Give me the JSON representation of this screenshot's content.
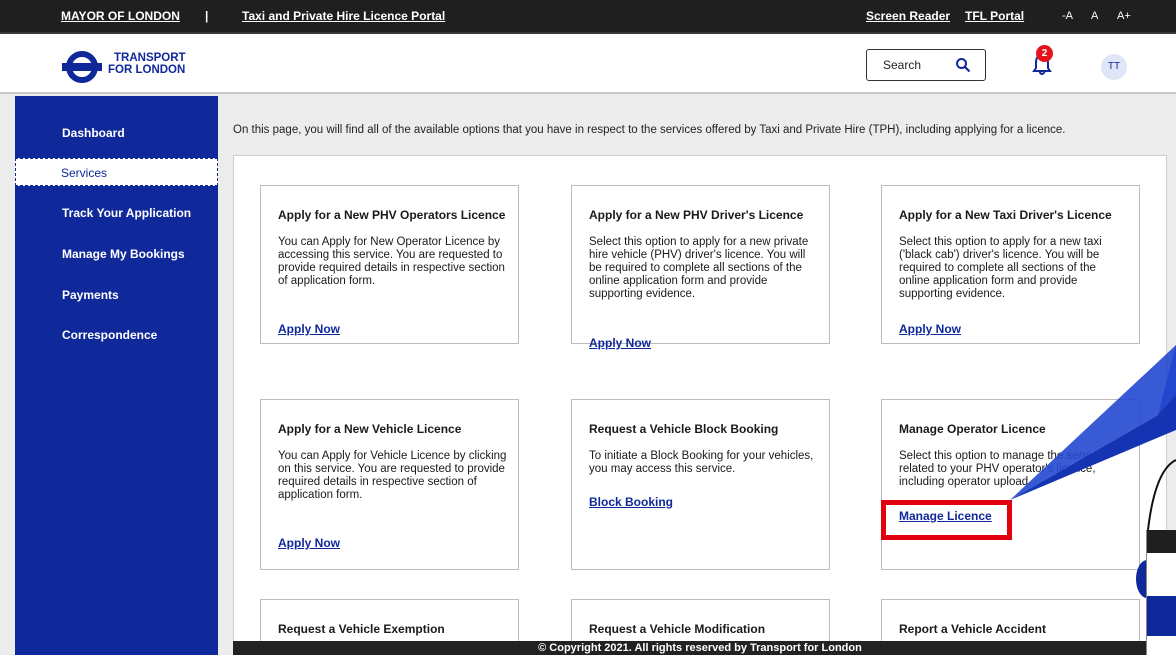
{
  "topbar": {
    "mayor": "MAYOR OF LONDON",
    "separator": "|",
    "portal": "Taxi and Private Hire Licence Portal",
    "screen_reader": "Screen Reader",
    "tfl_portal": "TFL Portal",
    "font_small": "-A",
    "font_normal": "A",
    "font_large": "A+"
  },
  "header": {
    "logo_line1": "TRANSPORT",
    "logo_line2": "FOR LONDON",
    "search_label": "Search",
    "notification_count": "2",
    "avatar_initials": "TT"
  },
  "sidebar": {
    "items": [
      {
        "label": "Dashboard"
      },
      {
        "label": "Services",
        "active": true
      },
      {
        "label": "Track Your Application"
      },
      {
        "label": "Manage My Bookings"
      },
      {
        "label": "Payments"
      },
      {
        "label": "Correspondence"
      }
    ]
  },
  "main": {
    "intro": "On this page, you will find all of the available options that you have in respect to the services offered by Taxi and Private Hire (TPH), including applying for a licence.",
    "cards": [
      {
        "title": "Apply for a New PHV Operators Licence",
        "desc": "You can Apply for New Operator Licence by accessing this service. You are requested to provide required details in respective section of application form.",
        "link": "Apply Now"
      },
      {
        "title": "Apply for a New PHV Driver's Licence",
        "desc": "Select this option to apply for a new private hire vehicle (PHV) driver's licence. You will be required to complete all sections of the online application form and provide supporting evidence.",
        "link": "Apply Now"
      },
      {
        "title": "Apply for a New Taxi Driver's Licence",
        "desc": "Select this option to apply for a new taxi ('black cab') driver's licence. You will be required to complete all sections of the online application form and provide supporting evidence.",
        "link": "Apply Now"
      },
      {
        "title": "Apply for a New Vehicle Licence",
        "desc": "You can Apply for Vehicle Licence by clicking on this service. You are requested to provide required details in respective section of application form.",
        "link": "Apply Now"
      },
      {
        "title": "Request a Vehicle Block Booking",
        "desc": "To initiate a Block Booking for your vehicles, you may access this service.",
        "link": "Block Booking"
      },
      {
        "title": "Manage Operator Licence",
        "desc": "Select this option to manage the services related to your PHV operator's licence, including operator upload.",
        "link": "Manage Licence"
      },
      {
        "title": "Request a Vehicle Exemption"
      },
      {
        "title": "Request a Vehicle Modification"
      },
      {
        "title": "Report a Vehicle Accident"
      }
    ]
  },
  "footer": {
    "copyright": "© Copyright 2021. All rights reserved by Transport for London"
  },
  "colors": {
    "brand_blue": "#10299a",
    "topbar": "#1f1f1f",
    "highlight_red": "#e00010",
    "badge_red": "#e5141c"
  }
}
